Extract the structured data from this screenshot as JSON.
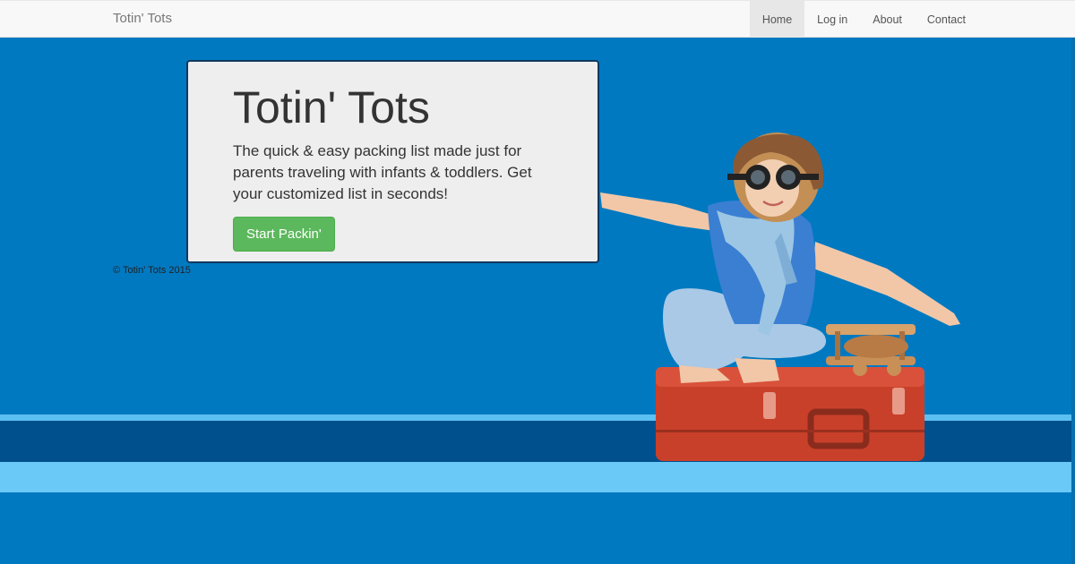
{
  "navbar": {
    "brand": "Totin' Tots",
    "items": [
      {
        "label": "Home",
        "active": true
      },
      {
        "label": "Log in",
        "active": false
      },
      {
        "label": "About",
        "active": false
      },
      {
        "label": "Contact",
        "active": false
      }
    ]
  },
  "hero": {
    "title": "Totin' Tots",
    "description": "The quick & easy packing list made just for parents traveling with infants & toddlers. Get your customized list in seconds!",
    "cta_label": "Start Packin'"
  },
  "footer": {
    "copyright": "© Totin' Tots 2015"
  },
  "colors": {
    "background": "#0079c1",
    "stripe_dark": "#00508e",
    "stripe_light": "#6ac9f7",
    "cta": "#5cb85c"
  }
}
